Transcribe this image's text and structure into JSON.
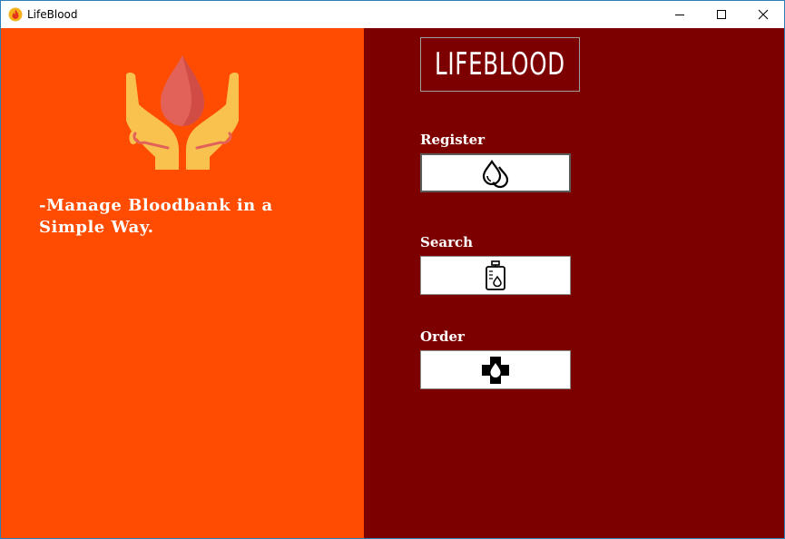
{
  "window": {
    "title": "LifeBlood",
    "controls": [
      "minimize-icon",
      "maximize-icon",
      "close-icon"
    ]
  },
  "colors": {
    "left_panel": "#ff4c00",
    "right_panel": "#7d0000",
    "hand_color": "#f9c24f",
    "drop_color": "#e2625a",
    "text": "#ffffff"
  },
  "left": {
    "logo_icon": "hands-holding-blood-drop-icon",
    "tagline": "-Manage Bloodbank in a Simple Way."
  },
  "right": {
    "brand": "LIFEBLOOD",
    "actions": [
      {
        "label": "Register",
        "icon": "blood-drops-icon"
      },
      {
        "label": "Search",
        "icon": "blood-bag-icon"
      },
      {
        "label": "Order",
        "icon": "medical-cross-drop-icon"
      }
    ]
  }
}
